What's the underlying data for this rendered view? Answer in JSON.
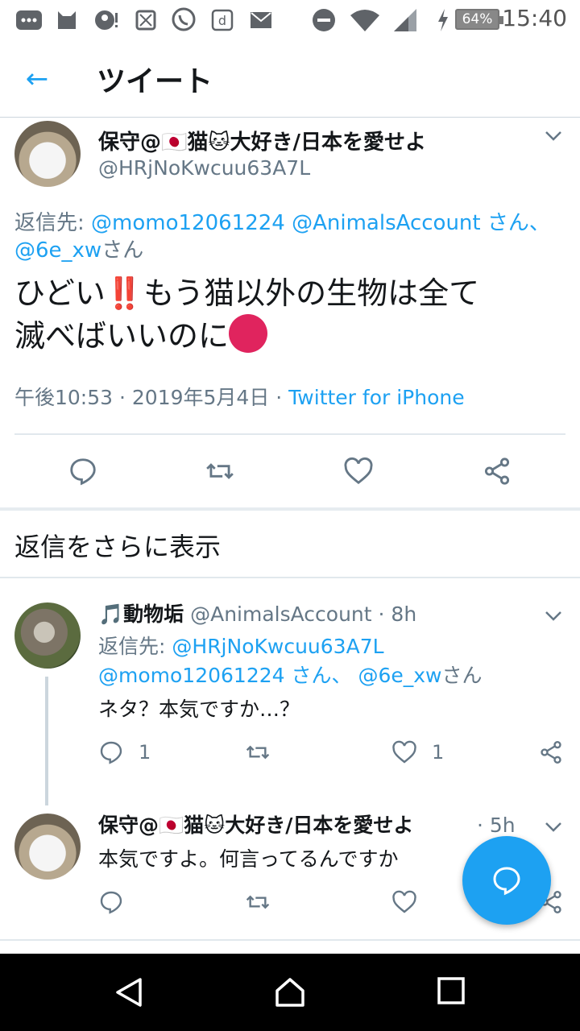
{
  "status_bar": {
    "time": "15:40",
    "battery": "64%",
    "icons": [
      "messages-icon",
      "cat-app-icon",
      "account-alert-icon",
      "sim-icon",
      "viber-icon",
      "d-app-icon",
      "mail-icon",
      "dnd-icon",
      "wifi-icon",
      "signal-icon",
      "charging-icon"
    ]
  },
  "header": {
    "back_icon": "←",
    "title": "ツイート"
  },
  "main_tweet": {
    "display_name": "保守@🇯🇵猫🐱大好き/日本を愛せよ",
    "handle": "@HRjNoKwcuu63A7L",
    "reply_prefix": "返信先:",
    "reply_handles_line1": "@momo12061224 @AnimalsAccount さん、",
    "reply_handles_line2": "@6e_xw",
    "reply_suffix": "さん",
    "text_line1a": "ひどい",
    "text_bang": "‼️",
    "text_line1b": "もう猫以外の生物は全て",
    "text_line2": "滅べばいいのに",
    "timestamp": "午後10:53 · 2019年5月4日 · ",
    "source": "Twitter for iPhone"
  },
  "more_replies": "返信をさらに表示",
  "replies": [
    {
      "display_name": "🎵動物垢",
      "handle": "@AnimalsAccount",
      "time": "· 8h",
      "reply_prefix": "返信先:",
      "reply_handle1": "@HRjNoKwcuu63A7L",
      "reply_handle2": "@momo12061224",
      "reply_mid": " さん、 ",
      "reply_handle3": "@6e_xw",
      "reply_suffix": "さん",
      "text": "ネタ？本気ですか…？",
      "reply_count": "1",
      "like_count": "1"
    },
    {
      "display_name": "保守@🇯🇵猫🐱大好き/日本を愛せよ",
      "time": "· 5h",
      "text": "本気ですよ。何言ってるんですか"
    }
  ],
  "colors": {
    "accent": "#1da1f2",
    "muted": "#657786",
    "anger": "#e0245e"
  }
}
